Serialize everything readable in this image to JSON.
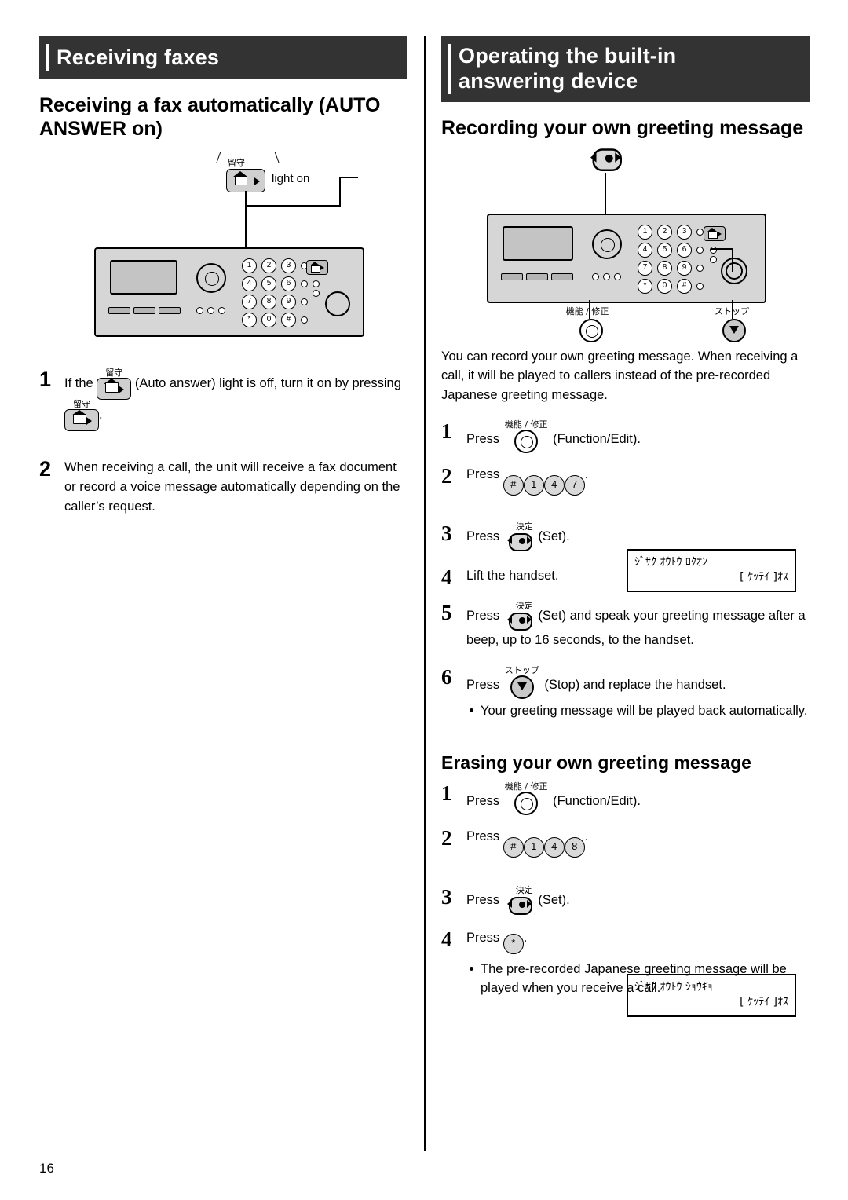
{
  "page": {
    "number": "16"
  },
  "left": {
    "banner": "Receiving faxes",
    "heading": "Receiving a fax automatically (AUTO ANSWER on)",
    "illustration": {
      "light_label": "light on",
      "jp_key_label": "留守",
      "keypad_rows": [
        [
          "1",
          "2",
          "3"
        ],
        [
          "4",
          "5",
          "6"
        ],
        [
          "7",
          "8",
          "9"
        ],
        [
          "*",
          "0",
          "#"
        ]
      ]
    },
    "steps": [
      {
        "num": "1",
        "text_before": "If the",
        "jp_label": "留守",
        "text_mid": "(Auto answer) light is off, turn it on by pressing",
        "text_after": "."
      },
      {
        "num": "2",
        "text": "When receiving a call, the unit will receive a fax document or record a voice message automatically depending on the caller’s request."
      }
    ]
  },
  "right": {
    "banner_line1": "Operating the built-in",
    "banner_line2": "answering device",
    "heading1": "Recording your own greeting message",
    "illustration": {
      "fn_label": "機能 / 修正",
      "stop_label": "ストップ",
      "keypad_rows": [
        [
          "1",
          "2",
          "3"
        ],
        [
          "4",
          "5",
          "6"
        ],
        [
          "7",
          "8",
          "9"
        ],
        [
          "*",
          "0",
          "#"
        ]
      ]
    },
    "intro": "You can record your own greeting message. When receiving a call, it will be played to callers instead of the pre-recorded Japanese greeting message.",
    "steps_record": [
      {
        "num": "1",
        "press": "Press",
        "jp": "機能 / 修正",
        "suffix": "(Function/Edit)."
      },
      {
        "num": "2",
        "press": "Press",
        "keys": [
          "#",
          "1",
          "4",
          "7"
        ],
        "suffix": "."
      },
      {
        "num": "3",
        "press": "Press",
        "jp": "決定",
        "suffix": "(Set)."
      },
      {
        "num": "4",
        "text": "Lift the handset."
      },
      {
        "num": "5",
        "press": "Press",
        "jp": "決定",
        "suffix": "(Set) and speak your greeting message after a beep, up to 16 seconds, to the handset."
      },
      {
        "num": "6",
        "press": "Press",
        "jp": "ストップ",
        "suffix": "(Stop) and replace the handset."
      }
    ],
    "record_bullet": "Your greeting message will be played back automatically.",
    "lcd1": {
      "line1": "ｼﾞｻｸ ｵｳﾄｳ ﾛｸｵﾝ",
      "line2": "[ ｹｯﾃｲ ]ｵｽ"
    },
    "heading2": "Erasing your own greeting message",
    "steps_erase": [
      {
        "num": "1",
        "press": "Press",
        "jp": "機能 / 修正",
        "suffix": "(Function/Edit)."
      },
      {
        "num": "2",
        "press": "Press",
        "keys": [
          "#",
          "1",
          "4",
          "8"
        ],
        "suffix": "."
      },
      {
        "num": "3",
        "press": "Press",
        "jp": "決定",
        "suffix": "(Set)."
      },
      {
        "num": "4",
        "press": "Press",
        "keys": [
          "*"
        ],
        "suffix": "."
      }
    ],
    "lcd2": {
      "line1": "ｼﾞｻｸ ｵｳﾄｳ ｼｮｳｷｮ",
      "line2": "[ ｹｯﾃｲ ]ｵｽ"
    },
    "erase_bullet": "The pre-recorded Japanese greeting message will be played when you receive a call."
  }
}
